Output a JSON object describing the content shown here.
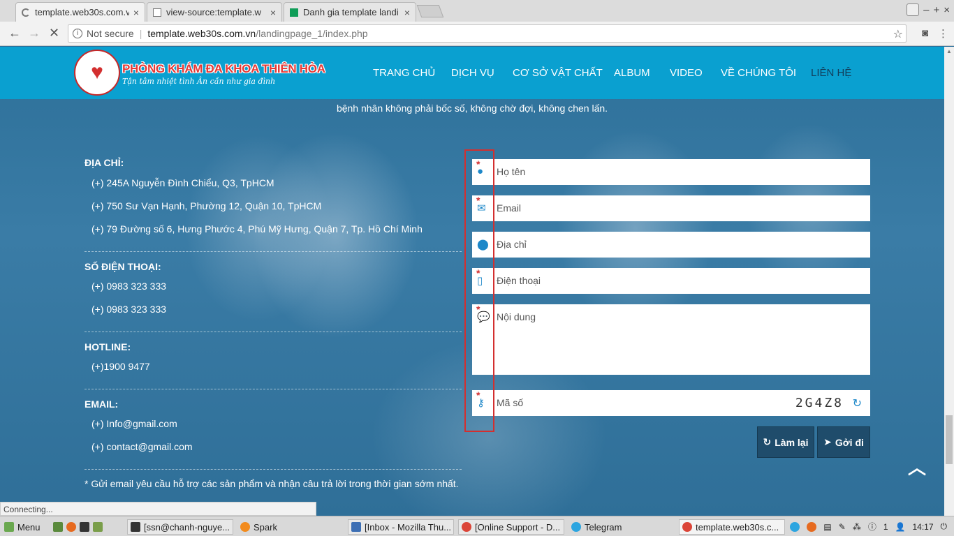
{
  "browser": {
    "tabs": [
      {
        "title": "template.web30s.com.vn"
      },
      {
        "title": "view-source:template.w"
      },
      {
        "title": "Danh gia template landi"
      }
    ],
    "url_security": "Not secure",
    "url_host": "template.web30s.com.vn",
    "url_path": "/landingpage_1/index.php",
    "status_text": "Connecting..."
  },
  "site": {
    "brand": "PHÒNG KHÁM ĐA KHOA THIÊN HÒA",
    "slogan": "Tận tâm nhiệt tình   Ân cần như gia đình",
    "menu": [
      "TRANG CHỦ",
      "DỊCH VỤ",
      "CƠ SỞ VẬT CHẤT",
      "ALBUM",
      "VIDEO",
      "VỀ CHÚNG TÔI",
      "LIÊN HỆ"
    ],
    "intro": "bệnh nhân không phải bốc số, không chờ đợi, không chen lấn."
  },
  "contact": {
    "address_heading": "ĐỊA CHỈ:",
    "addresses": [
      "(+) 245A Nguyễn Đình Chiểu, Q3, TpHCM",
      "(+) 750 Sư Vạn Hạnh, Phường 12, Quận 10, TpHCM",
      "(+) 79 Đường số 6, Hưng Phước 4, Phú Mỹ Hưng, Quận 7, Tp. Hồ Chí Minh"
    ],
    "phone_heading": "SỐ ĐIỆN THOẠI:",
    "phones": [
      "(+) 0983 323 333",
      "(+) 0983 323 333"
    ],
    "hotline_heading": "HOTLINE:",
    "hotline": "(+)1900 9477",
    "email_heading": "EMAIL:",
    "emails": [
      "(+) Info@gmail.com",
      "(+) contact@gmail.com"
    ],
    "note": "* Gửi email yêu cầu hỗ trợ các sản phẩm và nhận câu trả lời trong thời gian sớm nhất."
  },
  "form": {
    "name_placeholder": "Họ tên",
    "email_placeholder": "Email",
    "address_placeholder": "Địa chỉ",
    "phone_placeholder": "Điện thoại",
    "message_placeholder": "Nội dung",
    "code_placeholder": "Mã số",
    "captcha": "2G4Z8",
    "reset_label": "Làm lại",
    "submit_label": "Gởi đi"
  },
  "taskbar": {
    "menu_label": "Menu",
    "items": [
      "[ssn@chanh-nguye...",
      "Spark",
      "[Inbox - Mozilla Thu...",
      "[Online Support - D...",
      "Telegram",
      "template.web30s.c..."
    ],
    "tray_count": "1",
    "clock": "14:17"
  }
}
